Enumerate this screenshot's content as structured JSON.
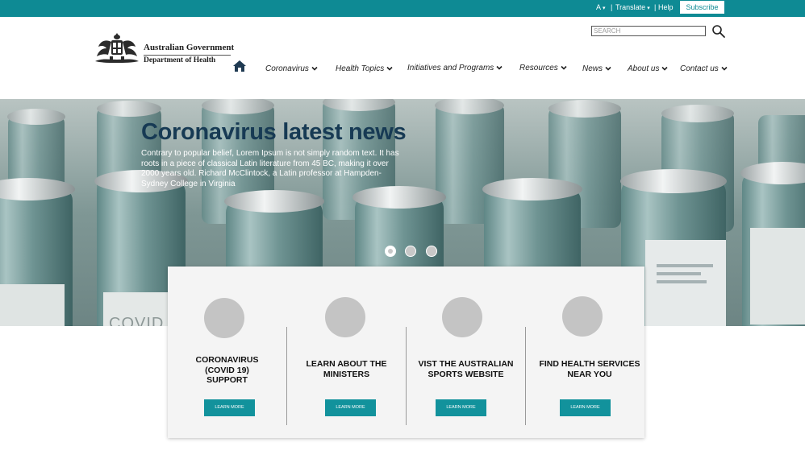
{
  "topbar": {
    "font_size_label": "A",
    "translate_label": "Translate",
    "help_label": "Help",
    "subscribe_label": "Subscribe"
  },
  "logo": {
    "line1": "Australian Government",
    "line2": "Department of Health"
  },
  "search": {
    "placeholder": "SEARCH"
  },
  "nav": {
    "items": [
      {
        "label": "Coronavirus"
      },
      {
        "label": "Health Topics"
      },
      {
        "label": "Initiatives and Programs"
      },
      {
        "label": "Resources"
      },
      {
        "label": "News"
      },
      {
        "label": "About us"
      },
      {
        "label": "Contact us"
      }
    ]
  },
  "hero": {
    "title": "Coronavirus latest news",
    "body": "Contrary to popular belief, Lorem Ipsum is not simply random text. It has roots in a piece of classical Latin literature from 45 BC, making it over 2000 years old. Richard McClintock, a Latin professor at Hampden-Sydney College in Virginia",
    "image_label": "COVID",
    "slides": 3,
    "active_slide": 1
  },
  "cards": [
    {
      "title": "CORONAVIRUS (COVID 19) SUPPORT",
      "button": "LEARN MORE"
    },
    {
      "title": "LEARN ABOUT THE MINISTERS",
      "button": "LEARN MORE"
    },
    {
      "title": "VIST THE AUSTRALIAN SPORTS WEBSITE",
      "button": "LEARN MORE"
    },
    {
      "title": "FIND HEALTH SERVICES NEAR YOU",
      "button": "LEARN MORE"
    }
  ],
  "colors": {
    "teal": "#0e8a94",
    "button_teal": "#12929c",
    "hero_title": "#173a54"
  }
}
